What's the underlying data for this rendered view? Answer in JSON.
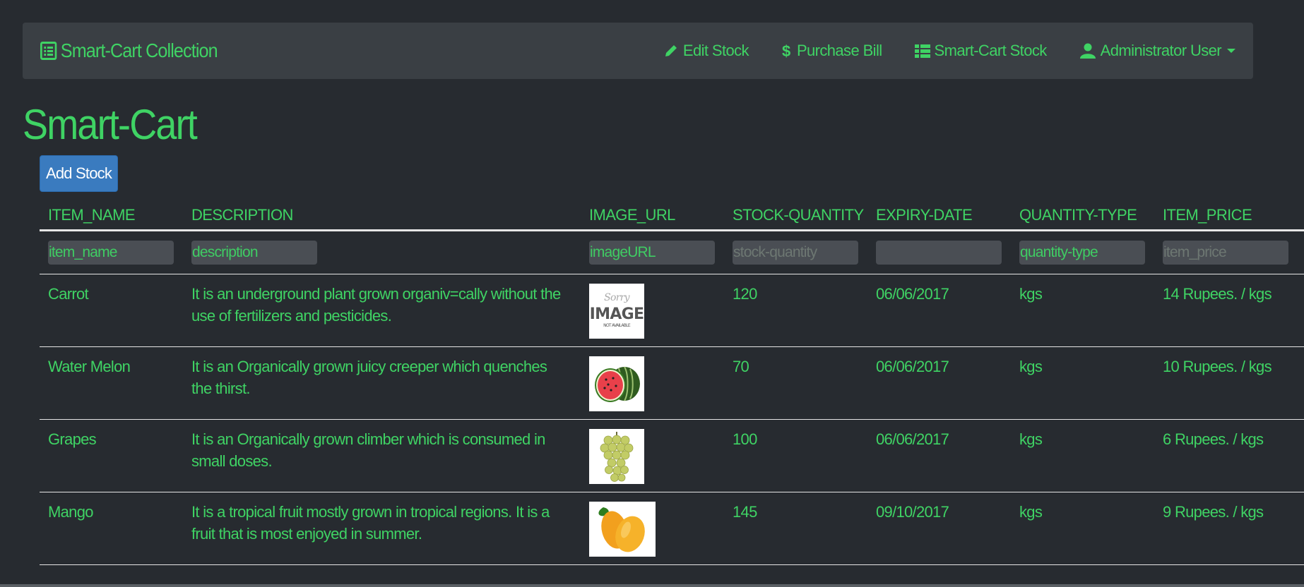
{
  "navbar": {
    "brand_label": "Smart-Cart Collection",
    "links": [
      {
        "label": "Edit Stock",
        "icon": "pencil-icon"
      },
      {
        "label": "Purchase Bill",
        "icon": "dollar-icon"
      },
      {
        "label": "Smart-Cart Stock",
        "icon": "table-icon"
      },
      {
        "label": "Administrator User",
        "icon": "user-icon"
      }
    ]
  },
  "page_title": "Smart-Cart",
  "add_button_label": "Add Stock",
  "table": {
    "headers": [
      "ITEM_NAME",
      "DESCRIPTION",
      "IMAGE_URL",
      "STOCK-QUANTITY",
      "EXPIRY-DATE",
      "QUANTITY-TYPE",
      "ITEM_PRICE"
    ],
    "filters": [
      "item_name",
      "description",
      "imageURL",
      "stock-quantity",
      "",
      "quantity-type",
      "item_price"
    ],
    "rows": [
      {
        "name": "Carrot",
        "description": "It is an underground plant grown organiv=cally without the use of fertilizers and pesticides.",
        "image": "image-not-available",
        "image_text": [
          "Sorry",
          "IMAGE",
          "NOT AVAILABLE"
        ],
        "quantity": "120",
        "expiry": "06/06/2017",
        "qty_type": "kgs",
        "price": "14 Rupees. / kgs"
      },
      {
        "name": "Water Melon",
        "description": "It is an Organically grown juicy creeper which quenches the thirst.",
        "image": "watermelon",
        "quantity": "70",
        "expiry": "06/06/2017",
        "qty_type": "kgs",
        "price": "10 Rupees. / kgs"
      },
      {
        "name": "Grapes",
        "description": "It is an Organically grown climber which is consumed in small doses.",
        "image": "grapes",
        "quantity": "100",
        "expiry": "06/06/2017",
        "qty_type": "kgs",
        "price": "6 Rupees. / kgs"
      },
      {
        "name": "Mango",
        "description": "It is a tropical fruit mostly grown in tropical regions. It is a fruit that is most enjoyed in summer.",
        "image": "mango",
        "quantity": "145",
        "expiry": "09/10/2017",
        "qty_type": "kgs",
        "price": "9 Rupees. / kgs"
      }
    ]
  },
  "colors": {
    "background": "#272b30",
    "navbar": "#3a3f44",
    "text": "#3fd364",
    "button": "#3a7bbf"
  }
}
